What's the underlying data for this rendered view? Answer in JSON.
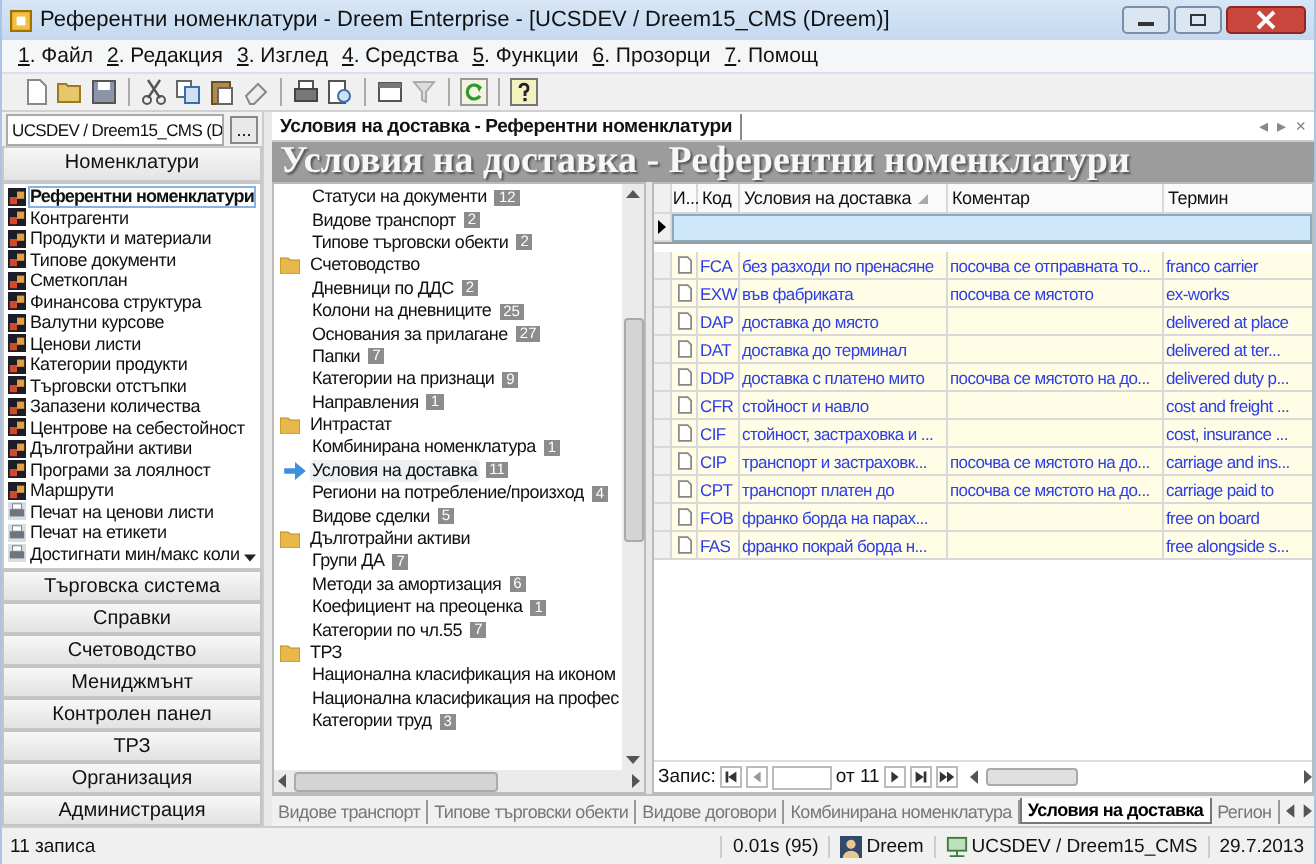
{
  "window": {
    "title": "Референтни номенклатури - Dreem Enterprise - [UCSDEV / Dreem15_CMS (Dreem)]"
  },
  "menu": [
    "1. Файл",
    "2. Редакция",
    "3. Изглед",
    "4. Средства",
    "5. Функции",
    "6. Прозорци",
    "7. Помощ"
  ],
  "connection": {
    "value": "UCSDEV / Dreem15_CMS (D",
    "button": "..."
  },
  "navigator": {
    "header": "Номенклатури",
    "items": [
      {
        "label": "Референтни номенклатури",
        "kind": "module",
        "selected": true
      },
      {
        "label": "Контрагенти",
        "kind": "module",
        "selected": false
      },
      {
        "label": "Продукти и материали",
        "kind": "module",
        "selected": false
      },
      {
        "label": "Типове документи",
        "kind": "module",
        "selected": false
      },
      {
        "label": "Сметкоплан",
        "kind": "module",
        "selected": false
      },
      {
        "label": "Финансова структура",
        "kind": "module",
        "selected": false
      },
      {
        "label": "Валутни курсове",
        "kind": "module",
        "selected": false
      },
      {
        "label": "Ценови листи",
        "kind": "module",
        "selected": false
      },
      {
        "label": "Категории продукти",
        "kind": "module",
        "selected": false
      },
      {
        "label": "Търговски отстъпки",
        "kind": "module",
        "selected": false
      },
      {
        "label": "Запазени количества",
        "kind": "module",
        "selected": false
      },
      {
        "label": "Центрове на себестойност",
        "kind": "module",
        "selected": false
      },
      {
        "label": "Дълготрайни активи",
        "kind": "module",
        "selected": false
      },
      {
        "label": "Програми за лоялност",
        "kind": "module",
        "selected": false
      },
      {
        "label": "Маршрути",
        "kind": "module",
        "selected": false
      },
      {
        "label": "Печат на ценови листи",
        "kind": "report",
        "selected": false
      },
      {
        "label": "Печат на етикети",
        "kind": "report",
        "selected": false
      },
      {
        "label": "Достигнати мин/макс коли",
        "kind": "report",
        "selected": false
      }
    ],
    "sections": [
      "Търговска система",
      "Справки",
      "Счетоводство",
      "Мениджмънт",
      "Контролен панел",
      "ТРЗ",
      "Организация",
      "Администрация"
    ]
  },
  "document_tab": {
    "label": "Условия на доставка - Референтни номенклатури",
    "controls": [
      "◂",
      "▸",
      "×"
    ]
  },
  "heading": "Условия на доставка - Референтни номенклатури",
  "tree": [
    {
      "kind": "item",
      "label": "Статуси на документи",
      "count": "12",
      "selected": false
    },
    {
      "kind": "item",
      "label": "Видове транспорт",
      "count": "2",
      "selected": false
    },
    {
      "kind": "item",
      "label": "Типове търговски обекти",
      "count": "2",
      "selected": false
    },
    {
      "kind": "folder",
      "label": "Счетоводство",
      "children": [
        {
          "kind": "item",
          "label": "Дневници по ДДС",
          "count": "2",
          "selected": false
        },
        {
          "kind": "item",
          "label": "Колони на дневниците",
          "count": "25",
          "selected": false
        },
        {
          "kind": "item",
          "label": "Основания за прилагане",
          "count": "27",
          "selected": false
        },
        {
          "kind": "item",
          "label": "Папки",
          "count": "7",
          "selected": false
        },
        {
          "kind": "item",
          "label": "Категории на признаци",
          "count": "9",
          "selected": false
        },
        {
          "kind": "item",
          "label": "Направления",
          "count": "1",
          "selected": false
        }
      ]
    },
    {
      "kind": "folder",
      "label": "Интрастат",
      "children": [
        {
          "kind": "item",
          "label": "Комбинирана номенклатура",
          "count": "1",
          "selected": false
        },
        {
          "kind": "item",
          "label": "Условия на доставка",
          "count": "11",
          "selected": true
        },
        {
          "kind": "item",
          "label": "Региони на потребление/произход",
          "count": "4",
          "selected": false
        },
        {
          "kind": "item",
          "label": "Видове сделки",
          "count": "5",
          "selected": false
        }
      ]
    },
    {
      "kind": "folder",
      "label": "Дълготрайни активи",
      "children": [
        {
          "kind": "item",
          "label": "Групи ДА",
          "count": "7",
          "selected": false
        },
        {
          "kind": "item",
          "label": "Методи за амортизация",
          "count": "6",
          "selected": false
        },
        {
          "kind": "item",
          "label": "Коефициент на преоценка",
          "count": "1",
          "selected": false
        },
        {
          "kind": "item",
          "label": "Категории по чл.55",
          "count": "7",
          "selected": false
        }
      ]
    },
    {
      "kind": "folder",
      "label": "ТРЗ",
      "children": [
        {
          "kind": "item",
          "label": "Национална класификация на иконом",
          "selected": false
        },
        {
          "kind": "item",
          "label": "Национална класификация на профес",
          "selected": false
        },
        {
          "kind": "item",
          "label": "Категории труд",
          "count": "3",
          "selected": false
        }
      ]
    }
  ],
  "grid": {
    "columns": [
      {
        "label": "И...",
        "sorted": false
      },
      {
        "label": "Код",
        "sorted": false
      },
      {
        "label": "Условия на доставка",
        "sorted": true
      },
      {
        "label": "Коментар",
        "sorted": false
      },
      {
        "label": "Термин",
        "sorted": false
      }
    ],
    "rows": [
      {
        "code": "FCA",
        "condition": "без разходи по пренасяне",
        "comment": "посочва се отправната то...",
        "term": "franco carrier"
      },
      {
        "code": "EXW",
        "condition": "във фабриката",
        "comment": "посочва се мястото",
        "term": "ex-works"
      },
      {
        "code": "DAP",
        "condition": "доставка до място",
        "comment": "",
        "term": "delivered at place"
      },
      {
        "code": "DAT",
        "condition": "доставка до терминал",
        "comment": "",
        "term": "delivered at ter..."
      },
      {
        "code": "DDP",
        "condition": "доставка с платено мито",
        "comment": "посочва се мястото на до...",
        "term": "delivered duty p..."
      },
      {
        "code": "CFR",
        "condition": "стойност и навло",
        "comment": "",
        "term": "cost and freight ..."
      },
      {
        "code": "CIF",
        "condition": "стойност, застраховка и ...",
        "comment": "",
        "term": "cost, insurance ..."
      },
      {
        "code": "CIP",
        "condition": "транспорт и застраховк...",
        "comment": "посочва се мястото на до...",
        "term": "carriage and ins..."
      },
      {
        "code": "CPT",
        "condition": "транспорт платен до",
        "comment": "посочва се мястото на до...",
        "term": "carriage paid to"
      },
      {
        "code": "FOB",
        "condition": "франко борда на парах...",
        "comment": "",
        "term": "free on board"
      },
      {
        "code": "FAS",
        "condition": "франко покрай борда н...",
        "comment": "",
        "term": "free alongside s..."
      }
    ]
  },
  "record_nav": {
    "label": "Запис:",
    "of": "от 11"
  },
  "bottom_tabs": [
    {
      "label": "Видове транспорт",
      "selected": false
    },
    {
      "label": "Типове търговски обекти",
      "selected": false
    },
    {
      "label": "Видове договори",
      "selected": false
    },
    {
      "label": "Комбинирана номенклатура",
      "selected": false
    },
    {
      "label": "Условия на доставка",
      "selected": true
    },
    {
      "label": "Регион",
      "selected": false
    }
  ],
  "status_bar": {
    "records": "11 записа",
    "timing": "0.01s (95)",
    "user": "Dreem",
    "connection": "UCSDEV / Dreem15_CMS",
    "date": "29.7.2013"
  }
}
